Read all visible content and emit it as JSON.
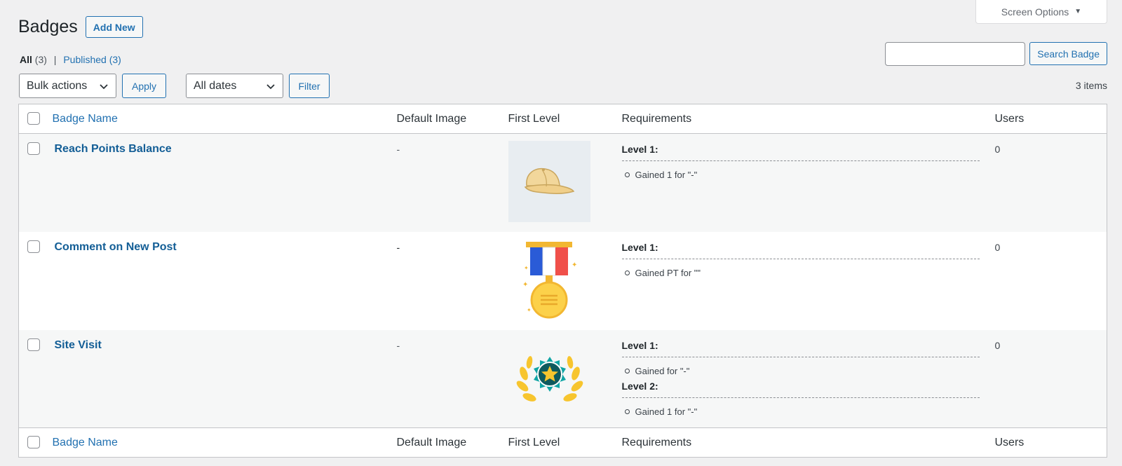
{
  "screen_options": {
    "label": "Screen Options"
  },
  "header": {
    "title": "Badges",
    "add_new_label": "Add New"
  },
  "filters_links": {
    "all_label": "All",
    "all_count": "(3)",
    "separator": "|",
    "published_label": "Published",
    "published_count": "(3)"
  },
  "search": {
    "value": "",
    "button_label": "Search Badge"
  },
  "tablenav": {
    "bulk_select": "Bulk actions",
    "apply_label": "Apply",
    "dates_select": "All dates",
    "filter_label": "Filter",
    "items_count": "3 items"
  },
  "columns": {
    "name": "Badge Name",
    "default_image": "Default Image",
    "first_level": "First Level",
    "requirements": "Requirements",
    "users": "Users"
  },
  "rows": [
    {
      "name": "Reach Points Balance",
      "default_image": "-",
      "first_level_icon": "cap-icon",
      "req": {
        "level1_title": "Level 1:",
        "level1_item": "Gained 1 for \"-\""
      },
      "users": "0"
    },
    {
      "name": "Comment on New Post",
      "default_image": "-",
      "first_level_icon": "medal-icon",
      "req": {
        "level1_title": "Level 1:",
        "level1_item": "Gained PT for \"\""
      },
      "users": "0"
    },
    {
      "name": "Site Visit",
      "default_image": "-",
      "first_level_icon": "laurel-star-icon",
      "req": {
        "level1_title": "Level 1:",
        "level1_item": "Gained for \"-\"",
        "level2_title": "Level 2:",
        "level2_item": "Gained 1 for \"-\""
      },
      "users": "0"
    }
  ],
  "colors": {
    "link": "#2271b1",
    "row_alt": "#f6f7f7",
    "border": "#c3c4c7"
  }
}
